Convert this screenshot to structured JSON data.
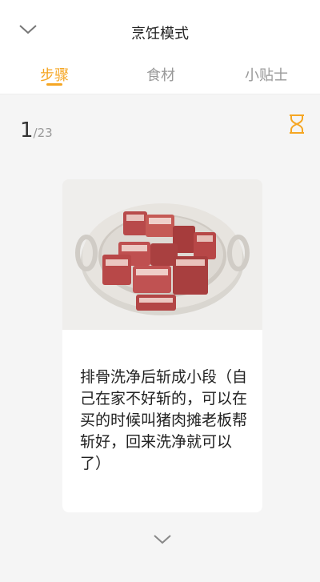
{
  "header": {
    "title": "烹饪模式"
  },
  "tabs": [
    {
      "label": "步骤",
      "active": true
    },
    {
      "label": "食材",
      "active": false
    },
    {
      "label": "小贴士",
      "active": false
    }
  ],
  "step": {
    "current": "1",
    "total": "/23"
  },
  "card": {
    "description": "排骨洗净后斩成小段（自己在家不好斩的，可以在买的时候叫猪肉摊老板帮斩好，回来洗净就可以了）"
  },
  "icons": {
    "collapse": "chevron-down-icon",
    "timer": "hourglass-icon",
    "next": "chevron-down-icon"
  },
  "colors": {
    "accent": "#f5a623",
    "background": "#f5f5f5"
  }
}
